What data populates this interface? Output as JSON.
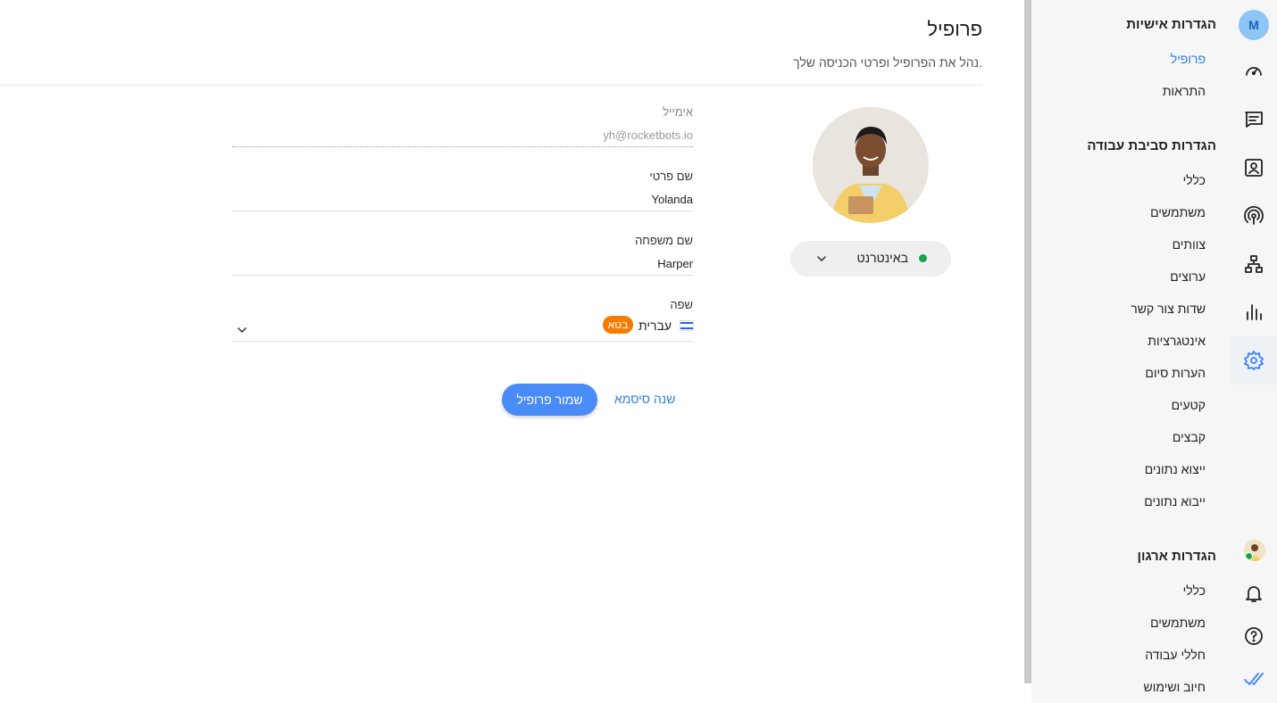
{
  "user": {
    "initial": "M"
  },
  "nav": {
    "personal": {
      "title": "הגדרות אישיות",
      "items": [
        {
          "label": "פרופיל",
          "active": true
        },
        {
          "label": "התראות"
        }
      ]
    },
    "workspace": {
      "title": "הגדרות סביבת עבודה",
      "items": [
        {
          "label": "כללי"
        },
        {
          "label": "משתמשים"
        },
        {
          "label": "צוותים"
        },
        {
          "label": "ערוצים"
        },
        {
          "label": "שדות צור קשר"
        },
        {
          "label": "אינטגרציות"
        },
        {
          "label": "הערות סיום"
        },
        {
          "label": "קטעים"
        },
        {
          "label": "קבצים"
        },
        {
          "label": "ייצוא נתונים"
        },
        {
          "label": "ייבוא נתונים"
        }
      ]
    },
    "organization": {
      "title": "הגדרות ארגון",
      "items": [
        {
          "label": "כללי"
        },
        {
          "label": "משתמשים"
        },
        {
          "label": "חללי עבודה"
        },
        {
          "label": "חיוב ושימוש"
        }
      ]
    }
  },
  "rail_icons": [
    "avatar",
    "dashboard-icon",
    "messages-icon",
    "contacts-icon",
    "broadcast-icon",
    "workflows-icon",
    "reports-icon",
    "settings-icon",
    "user-avatar",
    "notifications-icon",
    "help-icon",
    "done-icon"
  ],
  "header": {
    "title": "פרופיל",
    "subtitle": "נהל את הפרופיל ופרטי הכניסה שלך."
  },
  "status": {
    "label": "באינטרנט",
    "color": "#16a34a"
  },
  "form": {
    "email": {
      "label": "אימייל",
      "value": "yh@rocketbots.io"
    },
    "first_name": {
      "label": "שם פרטי",
      "value": "Yolanda"
    },
    "last_name": {
      "label": "שם משפחה",
      "value": "Harper"
    },
    "language": {
      "label": "שפה",
      "value": "עברית",
      "badge": "בטא"
    }
  },
  "actions": {
    "save": "שמור פרופיל",
    "change_password": "שנה סיסמא"
  },
  "colors": {
    "accent": "#4a8cf7",
    "link": "#2f7de1",
    "beta": "#f57c00"
  }
}
